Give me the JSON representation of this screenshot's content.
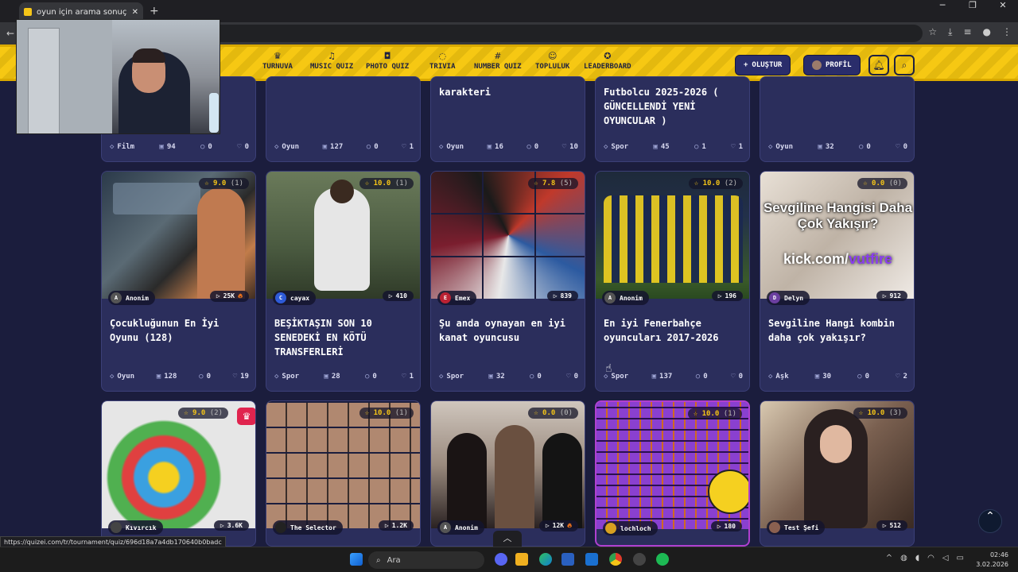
{
  "browser": {
    "tab_title": "oyun için arama sonuçları - Qu",
    "new_tab": "+",
    "status_url": "https://quizei.com/tr/tournament/quiz/696d18a7a4db170640b0badc"
  },
  "nav": {
    "items": [
      {
        "label": "TURNUVA",
        "icon": "trophy-icon"
      },
      {
        "label": "MUSIC QUIZ",
        "icon": "music-icon"
      },
      {
        "label": "PHOTO QUIZ",
        "icon": "camera-icon"
      },
      {
        "label": "TRIVIA",
        "icon": "chat-icon"
      },
      {
        "label": "NUMBER QUIZ",
        "icon": "hash-icon"
      },
      {
        "label": "TOPLULUK",
        "icon": "users-icon"
      },
      {
        "label": "LEADERBOARD",
        "icon": "medal-icon"
      }
    ],
    "create_label": "OLUŞTUR",
    "profile_label": "PROFİL"
  },
  "top_row": [
    {
      "title": "",
      "category": "Film",
      "count": "94",
      "comments": "0",
      "likes": "0"
    },
    {
      "title": "",
      "category": "Oyun",
      "count": "127",
      "comments": "0",
      "likes": "1"
    },
    {
      "title": "karakteri",
      "category": "Oyun",
      "count": "16",
      "comments": "0",
      "likes": "10"
    },
    {
      "title": "Futbolcu 2025-2026 ( GÜNCELLENDİ YENİ OYUNCULAR )",
      "category": "Spor",
      "count": "45",
      "comments": "1",
      "likes": "1"
    },
    {
      "title": "",
      "category": "Oyun",
      "count": "32",
      "comments": "0",
      "likes": "0"
    }
  ],
  "middle_row": [
    {
      "rating": "9.0",
      "votes": "(1)",
      "author": "Anonim",
      "author_initial": "A",
      "plays": "25K",
      "hot": true,
      "title": "Çocukluğunun En İyi Oyunu (128)",
      "category": "Oyun",
      "count": "128",
      "comments": "0",
      "likes": "19"
    },
    {
      "rating": "10.0",
      "votes": "(1)",
      "author": "cayax",
      "author_initial": "C",
      "plays": "410",
      "hot": false,
      "title": "BEŞİKTAŞIN SON 10 SENEDEKİ EN KÖTÜ TRANSFERLERİ",
      "category": "Spor",
      "count": "28",
      "comments": "0",
      "likes": "1"
    },
    {
      "rating": "7.8",
      "votes": "(5)",
      "author": "Emex",
      "author_initial": "E",
      "plays": "839",
      "hot": false,
      "title": "Şu anda oynayan en iyi kanat oyuncusu",
      "category": "Spor",
      "count": "32",
      "comments": "0",
      "likes": "0"
    },
    {
      "rating": "10.0",
      "votes": "(2)",
      "author": "Anonim",
      "author_initial": "A",
      "plays": "196",
      "hot": false,
      "title": "En iyi Fenerbahçe oyuncuları 2017-2026",
      "category": "Spor",
      "count": "137",
      "comments": "0",
      "likes": "0"
    },
    {
      "rating": "0.0",
      "votes": "(0)",
      "author": "Delyn",
      "author_initial": "D",
      "plays": "912",
      "hot": false,
      "title": "Sevgiline Hangi kombin daha çok yakışır?",
      "category": "Aşk",
      "count": "30",
      "comments": "0",
      "likes": "2",
      "image_text": "Sevgiline Hangisi Daha Çok Yakışır?",
      "image_url_text": "kick.com/",
      "image_url_accent": "vutfire"
    }
  ],
  "bottom_row": [
    {
      "rating": "9.0",
      "votes": "(2)",
      "author": "Kıvırcık",
      "plays": "3.6K",
      "hot": false,
      "crown": true
    },
    {
      "rating": "10.0",
      "votes": "(1)",
      "author": "The Selector",
      "plays": "1.2K",
      "hot": false
    },
    {
      "rating": "0.0",
      "votes": "(0)",
      "author": "Anonim",
      "author_initial": "A",
      "plays": "12K",
      "hot": true
    },
    {
      "rating": "10.0",
      "votes": "(1)",
      "author": "lochloch",
      "plays": "180",
      "hot": false
    },
    {
      "rating": "10.0",
      "votes": "(3)",
      "author": "Test Şefi",
      "plays": "512",
      "hot": false
    }
  ],
  "taskbar": {
    "search_placeholder": "Ara",
    "time": "02:46",
    "date": "3.02.2026"
  },
  "colors": {
    "background": "#1b1d3d",
    "card": "#2b2e5c",
    "nav_yellow": "#f6c813",
    "rating_gold": "#f5c518",
    "hot_orange": "#ff7a1a"
  }
}
